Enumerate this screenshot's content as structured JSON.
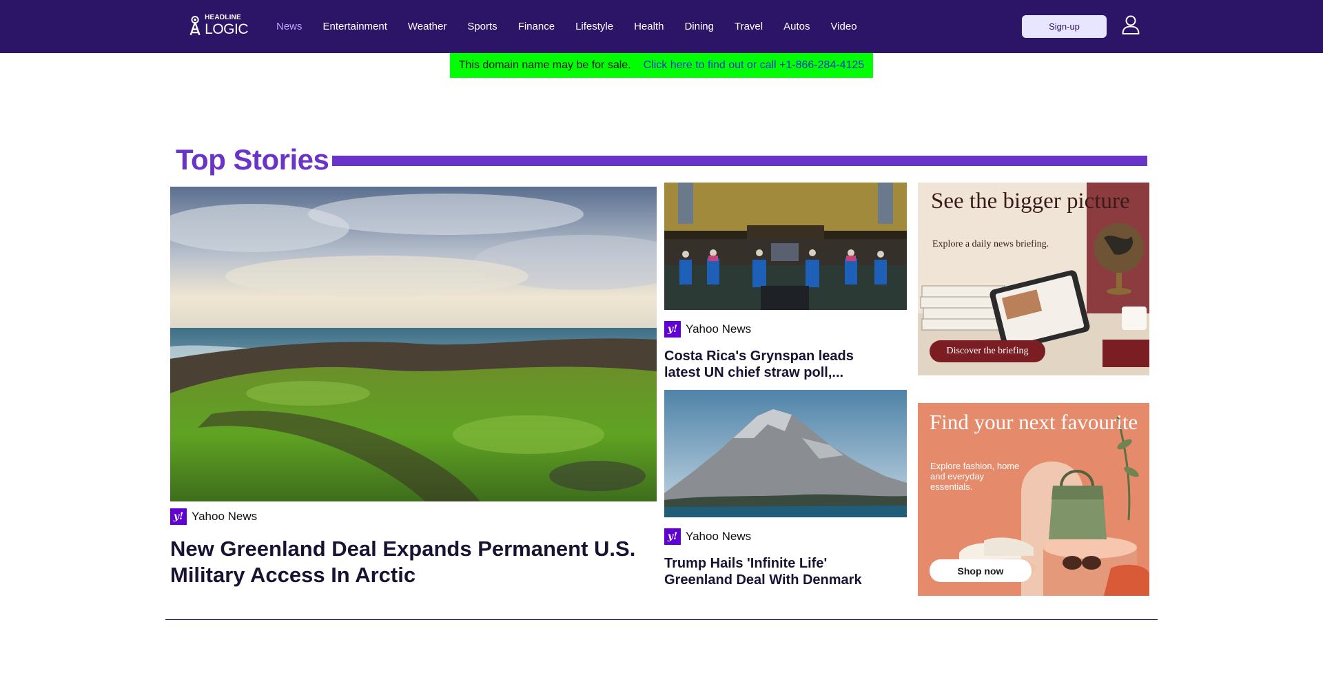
{
  "header": {
    "logo_top": "HEADLINE",
    "logo_bottom": "LOGIC",
    "nav": [
      "News",
      "Entertainment",
      "Weather",
      "Sports",
      "Finance",
      "Lifestyle",
      "Health",
      "Dining",
      "Travel",
      "Autos",
      "Video"
    ],
    "active_nav": "News",
    "signup_label": "Sign-up",
    "colors": {
      "bar": "#2c1566",
      "active": "#b9a6ff"
    }
  },
  "domain_banner": {
    "text": "This domain name may be for sale.",
    "link": "Click here to find out or call +1-866-284-4125"
  },
  "section": {
    "title": "Top Stories",
    "accent": "#6b34c9"
  },
  "main_story": {
    "source": "Yahoo News",
    "headline": "New Greenland Deal Expands Permanent U.S. Military Access In Arctic"
  },
  "side_stories": [
    {
      "source": "Yahoo News",
      "headline": "Costa Rica's Grynspan leads latest UN chief straw poll,..."
    },
    {
      "source": "Yahoo News",
      "headline": "Trump Hails 'Infinite Life' Greenland Deal With Denmark"
    }
  ],
  "ads": [
    {
      "title": "See the bigger picture",
      "subtitle": "Explore a daily news briefing.",
      "button": "Discover the briefing"
    },
    {
      "title": "Find your next favourite",
      "subtitle": "Explore fashion, home and everyday essentials.",
      "button": "Shop now"
    }
  ],
  "icons": {
    "user": "user-icon",
    "source_badge": "yahoo-badge-icon",
    "logo": "tower-logo-icon"
  }
}
